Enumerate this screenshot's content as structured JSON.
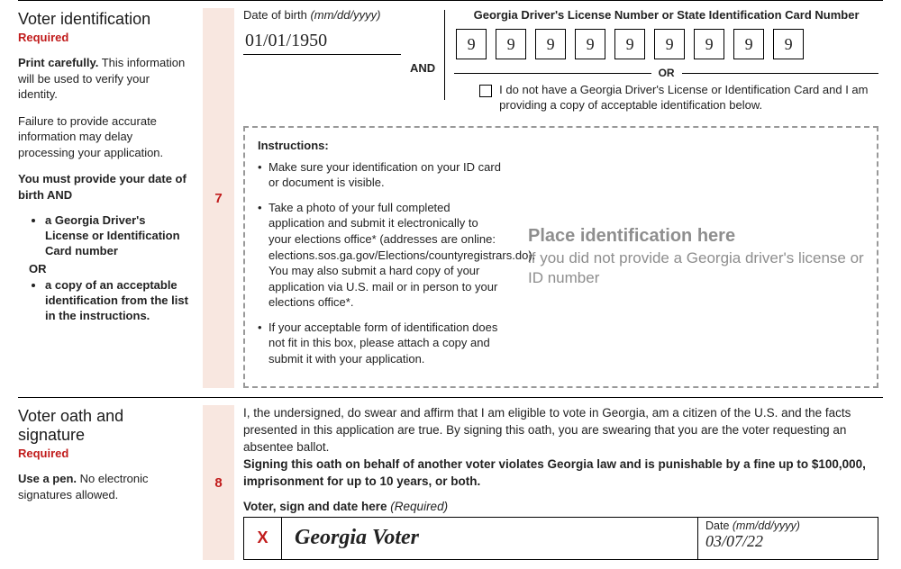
{
  "section7": {
    "num": "7",
    "title": "Voter identification",
    "required": "Required",
    "p1a": "Print carefully.",
    "p1b": " This information will be used to verify your identity.",
    "p2": "Failure to provide accurate information may delay processing your application.",
    "p3": "You must provide your date of birth AND",
    "bullet1": "a Georgia Driver's License or Identification Card number",
    "or": "OR",
    "bullet2": "a copy of an acceptable identification from the list in the instructions.",
    "dob_label": "Date of birth ",
    "dob_hint": "(mm/dd/yyyy)",
    "dob_value": "01/01/1950",
    "and": "AND",
    "id_heading": "Georgia Driver's License Number or State Identification Card Number",
    "digits": [
      "9",
      "9",
      "9",
      "9",
      "9",
      "9",
      "9",
      "9",
      "9"
    ],
    "or_sep": "OR",
    "chk_text": "I do not have a Georgia Driver's License or Identification Card and I am providing a copy of acceptable identification below.",
    "instr_title": "Instructions:",
    "instr1": "Make sure your identification on your ID card or document is visible.",
    "instr2": "Take a photo of your full completed application and submit it electronically to your elections office* (addresses are online: elections.sos.ga.gov/Elections/countyregistrars.do). You may also submit a hard copy of your  application via U.S. mail or in person to your elections office*.",
    "instr3": "If your acceptable form of identification does not fit in this box, please attach a copy and submit it with your application.",
    "ph_title": "Place identification here",
    "ph_sub": "if you did not provide a Georgia driver's license or ID number"
  },
  "section8": {
    "num": "8",
    "title": "Voter oath and signature",
    "required": "Required",
    "side_a": "Use a pen.",
    "side_b": " No electronic signatures allowed.",
    "body1": "I, the undersigned, do swear and affirm that I am eligible to vote in Georgia, am a citizen of the U.S. and the facts presented in this application are true. By signing this oath, you are swearing that you are the voter requesting an absentee ballot.",
    "body2": "Signing this oath on behalf of another voter violates Georgia law and is punishable by a fine up to $100,000, imprisonment for up to 10 years, or both.",
    "sign_label": "Voter, sign and date here ",
    "sign_req": "(Required)",
    "x": "X",
    "signature": "Georgia Voter",
    "date_label": "Date ",
    "date_hint": "(mm/dd/yyyy)",
    "date_value": "03/07/22"
  }
}
